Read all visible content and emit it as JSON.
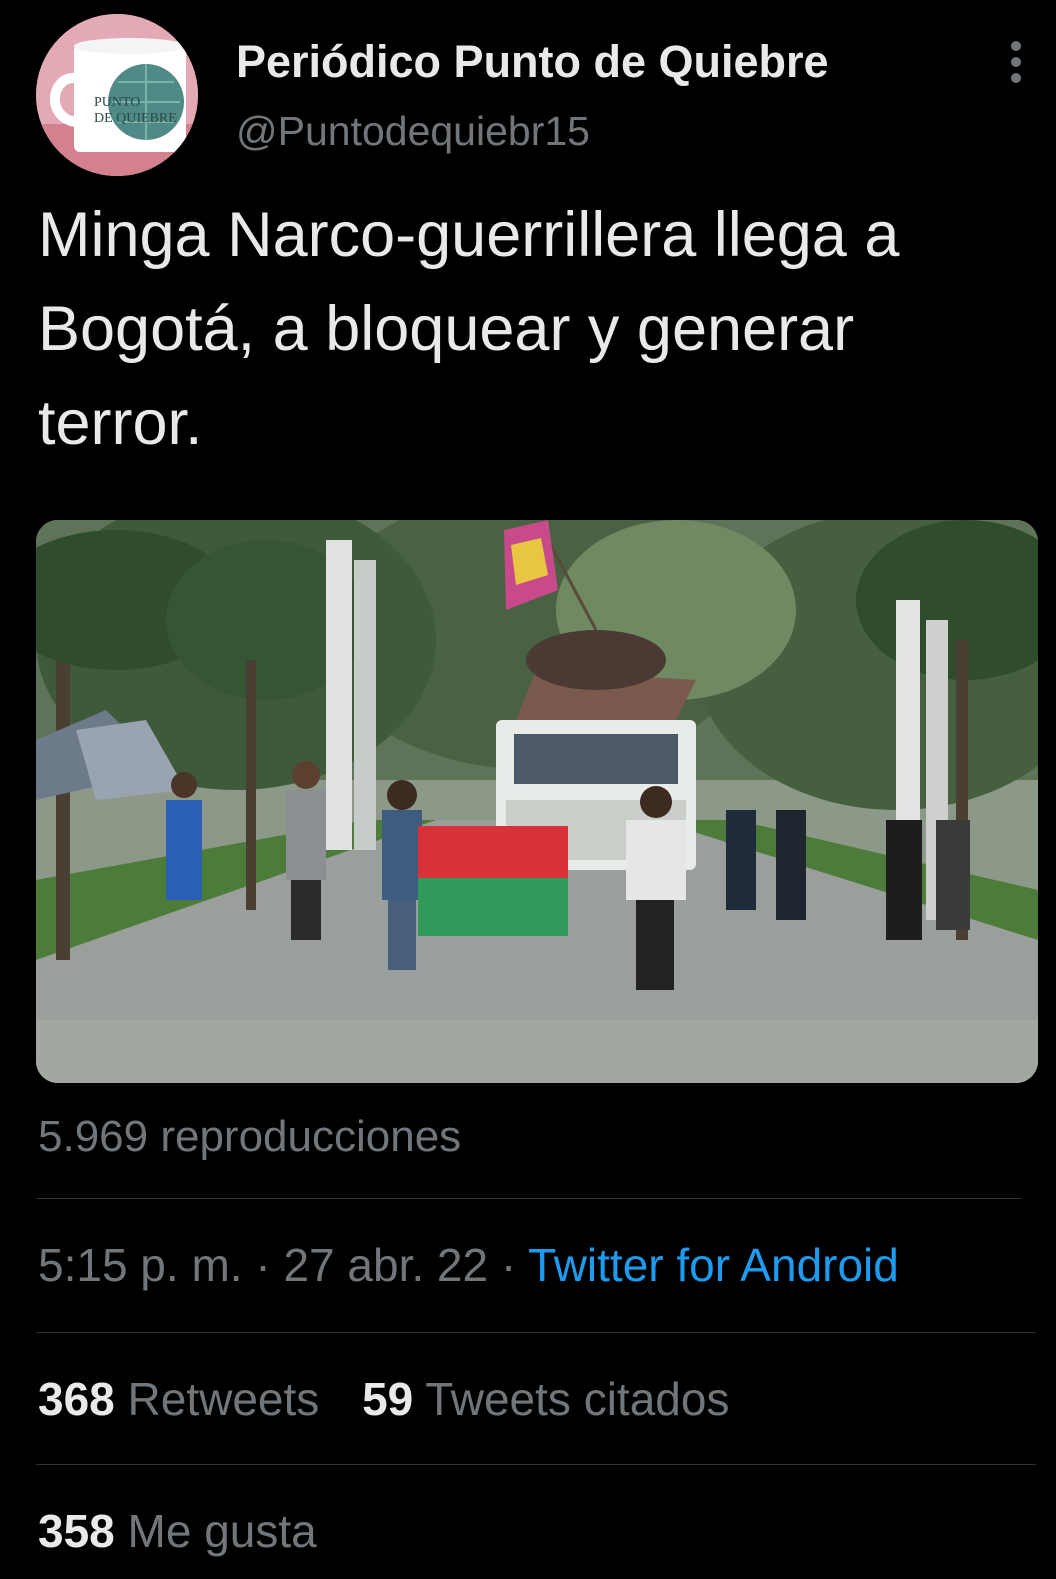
{
  "tweet": {
    "author": {
      "display_name": "Periódico Punto de Quiebre",
      "handle": "@Puntodequiebr15",
      "avatar_text_line1": "PUNTO",
      "avatar_text_line2": "DE QUIEBRE"
    },
    "more_icon": "more-vertical-icon",
    "text": "Minga Narco-guerrillera llega a Bogotá, a bloquear y generar terror.",
    "media": {
      "type": "video",
      "thumbnail": "photo"
    },
    "views_label": "5.969 reproducciones",
    "time": "5:15 p. m.",
    "separator": " · ",
    "date": "27 abr. 22",
    "source": "Twitter for Android",
    "stats": {
      "retweets_count": "368",
      "retweets_label": "Retweets",
      "quotes_count": "59",
      "quotes_label": "Tweets citados",
      "likes_count": "358",
      "likes_label": "Me gusta"
    }
  },
  "colors": {
    "background": "#000000",
    "text_primary": "#e7e9ea",
    "text_secondary": "#71767b",
    "link": "#1d9bf0",
    "divider": "#2f3336"
  }
}
